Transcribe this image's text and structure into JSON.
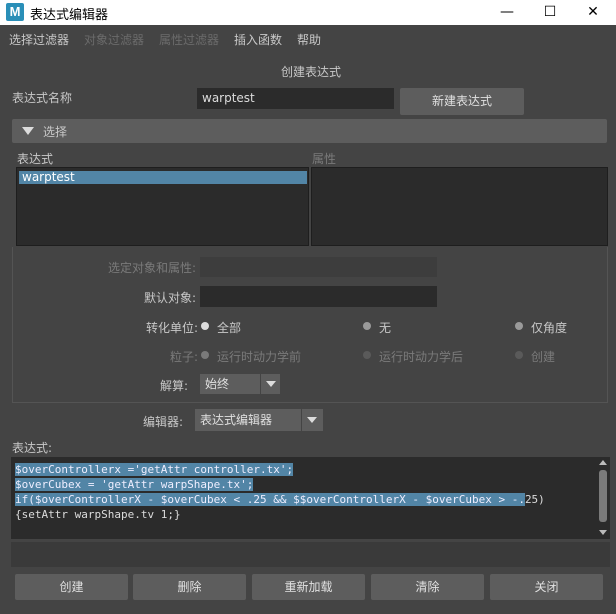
{
  "window": {
    "app_logo": "M",
    "title": "表达式编辑器",
    "minimize_glyph": "—",
    "maximize_glyph": "☐",
    "close_glyph": "✕"
  },
  "menu": {
    "items": [
      {
        "label": "选择过滤器",
        "enabled": true
      },
      {
        "label": "对象过滤器",
        "enabled": false
      },
      {
        "label": "属性过滤器",
        "enabled": false
      },
      {
        "label": "插入函数",
        "enabled": true
      },
      {
        "label": "帮助",
        "enabled": true
      }
    ]
  },
  "heading": "创建表达式",
  "name_row": {
    "label": "表达式名称",
    "value": "warptest",
    "new_button": "新建表达式"
  },
  "select_frame": {
    "title": "选择",
    "expressions_label": "表达式",
    "attributes_label": "属性",
    "expressions": [
      "warptest"
    ],
    "selected_expression": "warptest"
  },
  "options": {
    "selected_obj_label": "选定对象和属性:",
    "selected_obj_value": "",
    "default_obj_label": "默认对象:",
    "default_obj_value": "",
    "units_label": "转化单位:",
    "units": [
      {
        "label": "全部",
        "selected": true
      },
      {
        "label": "无",
        "selected": false
      },
      {
        "label": "仅角度",
        "selected": false
      }
    ],
    "particle_label": "粒子:",
    "particle": [
      {
        "label": "运行时动力学前",
        "selected": true
      },
      {
        "label": "运行时动力学后",
        "selected": false
      },
      {
        "label": "创建",
        "selected": false
      }
    ],
    "evaluate_label": "解算:",
    "evaluate_value": "始终"
  },
  "editor_row": {
    "label": "编辑器:",
    "value": "表达式编辑器"
  },
  "expression": {
    "label": "表达式:",
    "lines": [
      {
        "sel": "$overControllerx ='getAttr controller.tx';",
        "rest": ""
      },
      {
        "sel": "$overCubex = 'getAttr warpShape.tx';",
        "rest": ""
      },
      {
        "sel": "if($overControllerX - $overCubex < .25 && $$overControllerX - $overCubex > -.",
        "rest": "25)"
      },
      {
        "sel": "",
        "rest": "{setAttr warpShape.tv 1;}"
      }
    ]
  },
  "buttons": {
    "create": "创建",
    "delete": "删除",
    "reload": "重新加载",
    "clear": "清除",
    "close": "关闭"
  }
}
